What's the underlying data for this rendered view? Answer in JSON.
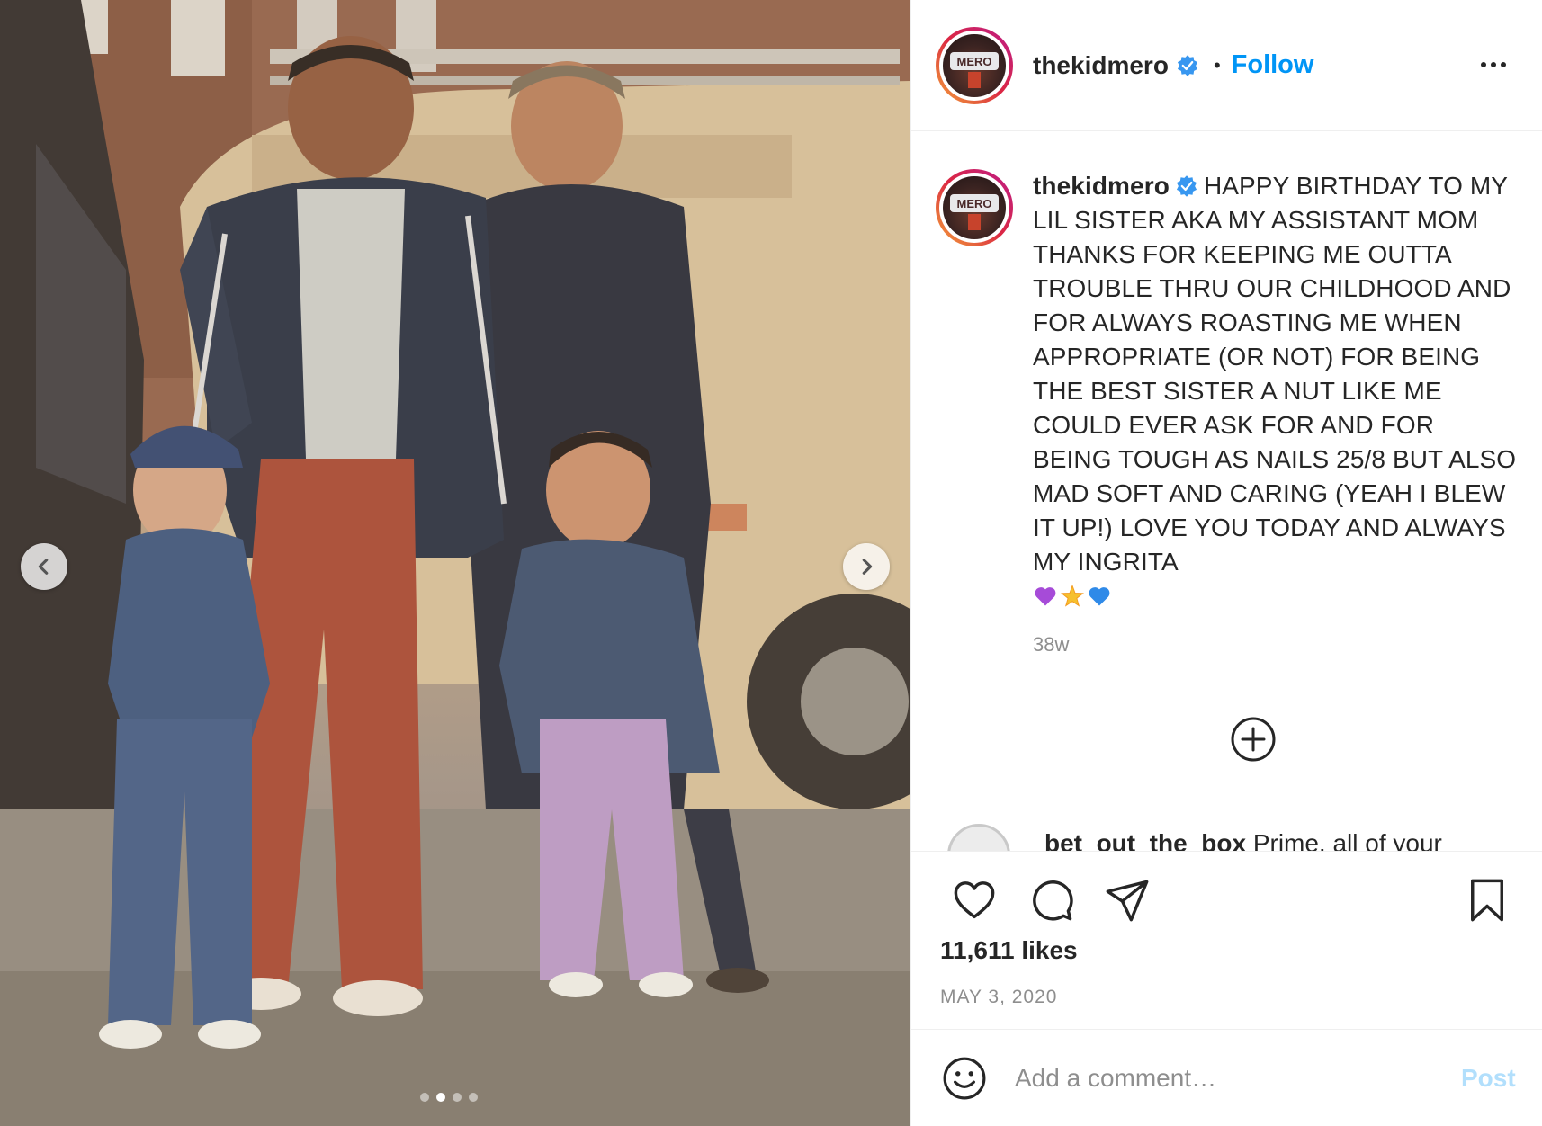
{
  "post": {
    "author": {
      "username": "thekidmero",
      "verified": true,
      "avatar_text": "MERO"
    },
    "follow_label": "Follow",
    "separator": "•",
    "caption": {
      "username": "thekidmero",
      "text": "HAPPY BIRTHDAY TO MY LIL SISTER AKA MY ASSISTANT MOM THANKS FOR KEEPING ME OUTTA TROUBLE THRU OUR CHILDHOOD AND FOR ALWAYS ROASTING ME WHEN APPROPRIATE (OR NOT) FOR BEING THE BEST SISTER A NUT LIKE ME COULD EVER ASK FOR AND FOR BEING TOUGH AS NAILS 25/8 BUT ALSO MAD SOFT AND CARING (YEAH I BLEW IT UP!) LOVE YOU TODAY AND ALWAYS MY INGRITA",
      "emojis": [
        "purple-heart",
        "glowing-star",
        "blue-heart"
      ],
      "time_ago": "38w"
    },
    "next_comment": {
      "username": "bet_out_the_box",
      "text": "Prime, all of your"
    },
    "likes": "11,611 likes",
    "date": "MAY 3, 2020",
    "comment_input": {
      "placeholder": "Add a comment…",
      "value": ""
    },
    "post_button": "Post",
    "carousel": {
      "total": 4,
      "active_index": 1
    },
    "icons": {
      "more": "more-options-icon",
      "like": "heart-icon",
      "comment": "comment-icon",
      "share": "share-icon",
      "save": "bookmark-icon",
      "load_more": "plus-circle-icon",
      "emoji": "smiley-icon",
      "prev": "chevron-left-icon",
      "next": "chevron-right-icon"
    },
    "colors": {
      "accent": "#0095f6",
      "verified": "#3897f0",
      "post_disabled": "#b2dffc",
      "muted": "#8e8e8e",
      "text": "#262626"
    }
  }
}
